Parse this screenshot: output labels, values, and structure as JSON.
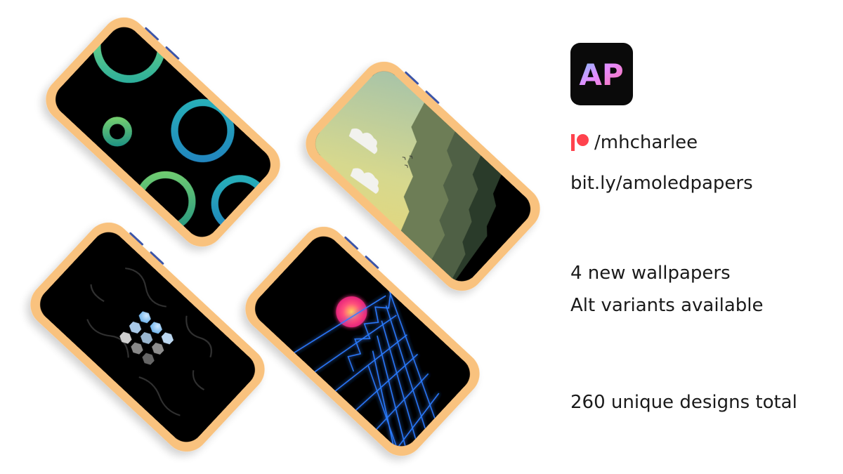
{
  "app": {
    "icon_name": "amoled-papers-app-icon",
    "icon_letters": "AP",
    "icon_background": "#0a0a0a"
  },
  "patreon": {
    "icon_name": "patreon-icon",
    "brand_color": "#ff424d",
    "handle": "/mhcharlee"
  },
  "link": {
    "url_text": "bit.ly/amoledpapers"
  },
  "announcement": {
    "line1": "4 new wallpapers",
    "line2": "Alt variants available",
    "total": "260 unique designs total"
  },
  "phones": [
    {
      "name": "phone-rings-wallpaper",
      "wallpaper": "green and teal rings"
    },
    {
      "name": "phone-mountains-wallpaper",
      "wallpaper": "mountains with clouds"
    },
    {
      "name": "phone-hexagons-wallpaper",
      "wallpaper": "hexagon dots"
    },
    {
      "name": "phone-synthwave-wallpaper",
      "wallpaper": "neon grid with sun"
    }
  ],
  "colors": {
    "phone_frame": "#f9c27e",
    "screen": "#000000",
    "background": "#ffffff"
  }
}
